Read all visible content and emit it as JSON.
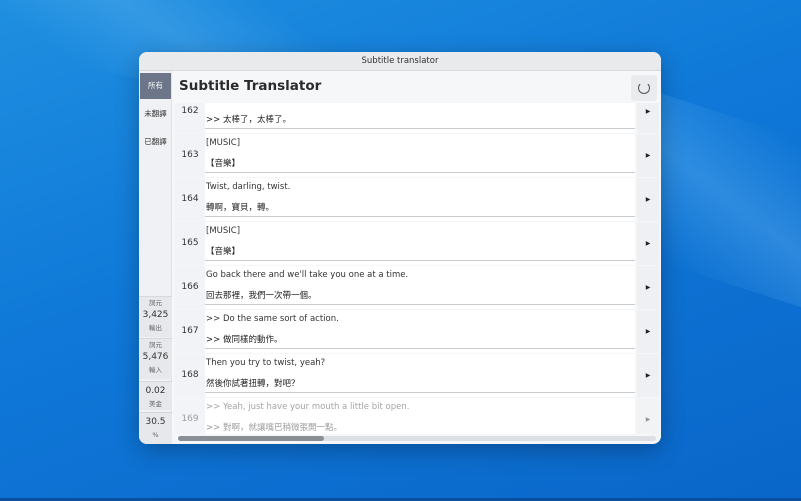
{
  "window": {
    "title": "Subtitle translator"
  },
  "header": {
    "title": "Subtitle Translator"
  },
  "sidebar": {
    "items": [
      {
        "label": "所有"
      },
      {
        "label": "未翻譯"
      },
      {
        "label": "已翻譯"
      }
    ],
    "stats": [
      {
        "top": "詞元",
        "value": "3,425",
        "bottom": "輸出"
      },
      {
        "top": "詞元",
        "value": "5,476",
        "bottom": "輸入"
      },
      {
        "value": "0.02",
        "bottom": "美金"
      },
      {
        "value": "30.5",
        "bottom": "%"
      }
    ]
  },
  "rows": [
    {
      "num": "162",
      "src": "",
      "tgt": ">> 太棒了，太棒了。"
    },
    {
      "num": "163",
      "src": "[MUSIC]",
      "tgt": "【音樂】"
    },
    {
      "num": "164",
      "src": "Twist, darling, twist.",
      "tgt": "轉啊，寶貝，轉。"
    },
    {
      "num": "165",
      "src": "[MUSIC]",
      "tgt": "【音樂】"
    },
    {
      "num": "166",
      "src": "Go back there and we'll take you one at a time.",
      "tgt": "回去那裡，我們一次帶一個。"
    },
    {
      "num": "167",
      "src": ">> Do the same sort of action.",
      "tgt": ">> 做同樣的動作。"
    },
    {
      "num": "168",
      "src": "Then you try to twist, yeah?",
      "tgt": "然後你試著扭轉，對吧？"
    },
    {
      "num": "169",
      "src": ">> Yeah, just have your mouth a little bit open.",
      "tgt": ">> 對啊，就讓嘴巴稍微張開一點。"
    }
  ],
  "scroll": {
    "position": 0.3
  }
}
